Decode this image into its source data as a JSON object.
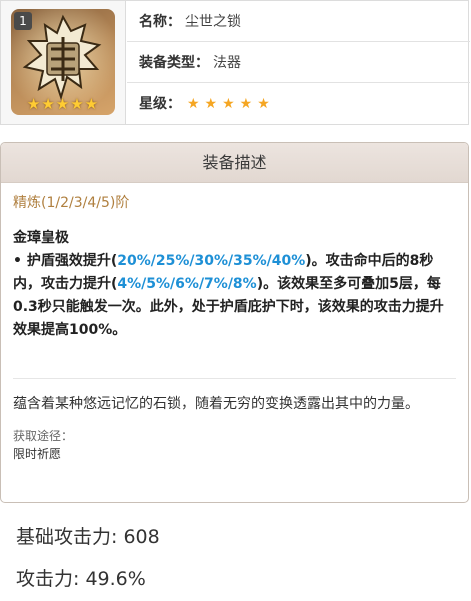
{
  "item": {
    "refine_badge": "1",
    "stars_glyph": "★★★★★",
    "name_label": "名称：",
    "name_value": "尘世之锁",
    "type_label": "装备类型：",
    "type_value": "法器",
    "rarity_label": "星级：",
    "rarity_stars": "★★★★★"
  },
  "description": {
    "header": "装备描述",
    "refine_levels": "精炼(1/2/3/4/5)阶",
    "effect_name": "金璋皇极",
    "effect_p1": "• 护盾强效提升(",
    "effect_v1": "20%/25%/30%/35%/40%",
    "effect_p2": ")。攻击命中后的8秒内，攻击力提升(",
    "effect_v2": "4%/5%/6%/7%/8%",
    "effect_p3": ")。该效果至多可叠加5层，每0.3秒只能触发一次。此外，处于护盾庇护下时，该效果的攻击力提升效果提高100%。",
    "lore": "蕴含着某种悠远记忆的石锁，随着无穷的变换透露出其中的力量。",
    "source_label": "获取途径：",
    "source_value": "限时祈愿"
  },
  "stats": {
    "base_atk": "基础攻击力: 608",
    "atk": "攻击力: 49.6%"
  },
  "colors": {
    "highlight": "#1e90d6",
    "refine_title": "#b08040",
    "star": "#f5a623"
  }
}
